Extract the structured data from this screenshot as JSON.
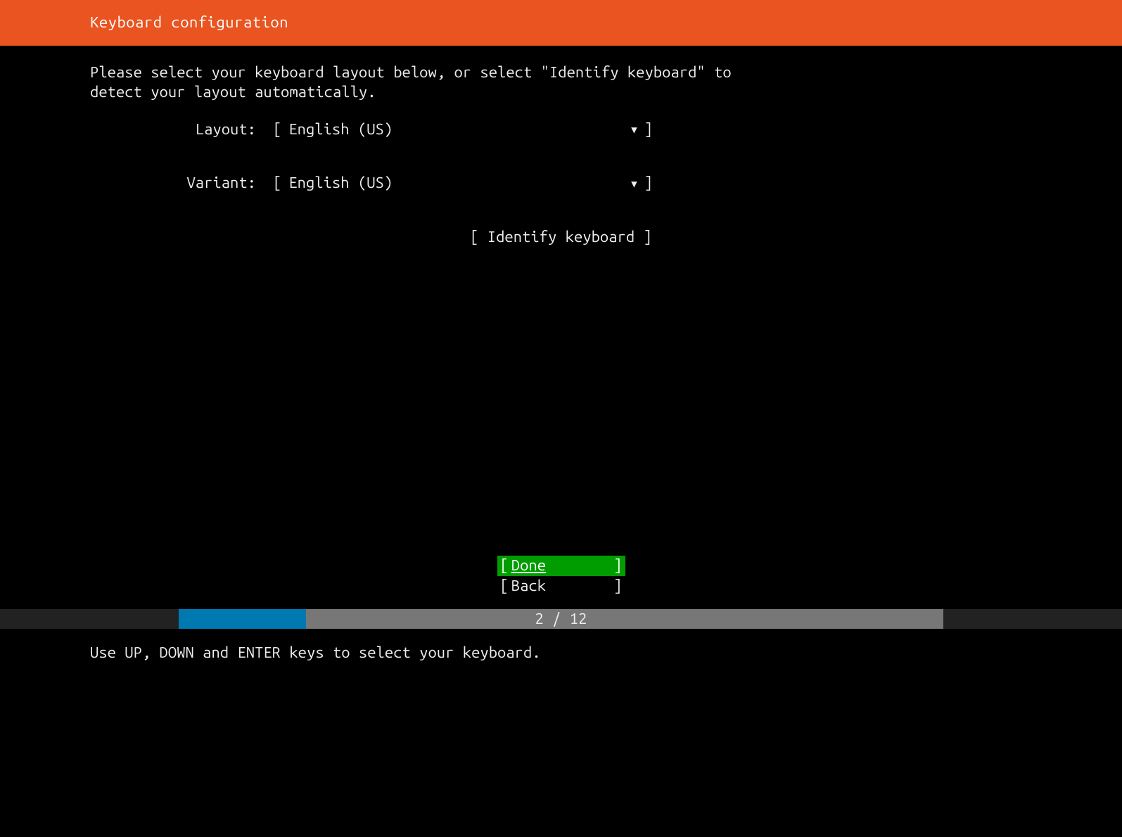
{
  "header": {
    "title": "Keyboard configuration"
  },
  "content": {
    "instruction": "Please select your keyboard layout below, or select \"Identify keyboard\" to\ndetect your layout automatically.",
    "layout": {
      "label": "Layout:",
      "value": "English (US)"
    },
    "variant": {
      "label": "Variant:",
      "value": "English (US)"
    },
    "identify_label": "Identify keyboard"
  },
  "footer": {
    "done_label": "Done",
    "back_label": "Back"
  },
  "progress": {
    "current": 2,
    "total": 12,
    "text": "2 / 12"
  },
  "hint": "Use UP, DOWN and ENTER keys to select your keyboard."
}
